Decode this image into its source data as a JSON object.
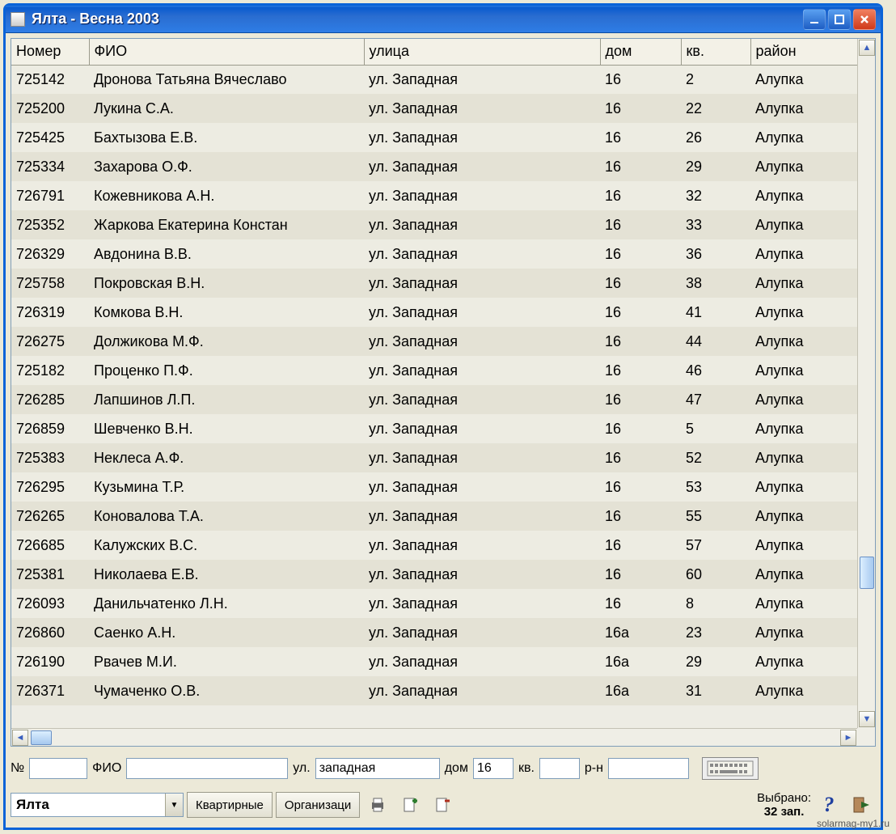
{
  "window": {
    "title": "Ялта  - Весна 2003"
  },
  "table": {
    "headers": {
      "num": "Номер",
      "fio": "ФИО",
      "street": "улица",
      "house": "дом",
      "kv": "кв.",
      "district": "район"
    },
    "rows": [
      {
        "num": "725142",
        "fio": "Дронова Татьяна Вячеславо",
        "street": "ул. Западная",
        "house": "16",
        "kv": "2",
        "district": "Алупка"
      },
      {
        "num": "725200",
        "fio": "Лукина С.А.",
        "street": "ул. Западная",
        "house": "16",
        "kv": "22",
        "district": "Алупка"
      },
      {
        "num": "725425",
        "fio": "Бахтызова Е.В.",
        "street": "ул. Западная",
        "house": "16",
        "kv": "26",
        "district": "Алупка"
      },
      {
        "num": "725334",
        "fio": "Захарова О.Ф.",
        "street": "ул. Западная",
        "house": "16",
        "kv": "29",
        "district": "Алупка"
      },
      {
        "num": "726791",
        "fio": "Кожевникова А.Н.",
        "street": "ул. Западная",
        "house": "16",
        "kv": "32",
        "district": "Алупка"
      },
      {
        "num": "725352",
        "fio": "Жаркова Екатерина Констан",
        "street": "ул. Западная",
        "house": "16",
        "kv": "33",
        "district": "Алупка"
      },
      {
        "num": "726329",
        "fio": "Авдонина В.В.",
        "street": "ул. Западная",
        "house": "16",
        "kv": "36",
        "district": "Алупка"
      },
      {
        "num": "725758",
        "fio": "Покровская В.Н.",
        "street": "ул. Западная",
        "house": "16",
        "kv": "38",
        "district": "Алупка"
      },
      {
        "num": "726319",
        "fio": "Комкова В.Н.",
        "street": "ул. Западная",
        "house": "16",
        "kv": "41",
        "district": "Алупка"
      },
      {
        "num": "726275",
        "fio": "Должикова М.Ф.",
        "street": "ул. Западная",
        "house": "16",
        "kv": "44",
        "district": "Алупка"
      },
      {
        "num": "725182",
        "fio": "Проценко П.Ф.",
        "street": "ул. Западная",
        "house": "16",
        "kv": "46",
        "district": "Алупка"
      },
      {
        "num": "726285",
        "fio": "Лапшинов Л.П.",
        "street": "ул. Западная",
        "house": "16",
        "kv": "47",
        "district": "Алупка"
      },
      {
        "num": "726859",
        "fio": "Шевченко В.Н.",
        "street": "ул. Западная",
        "house": "16",
        "kv": "5",
        "district": "Алупка"
      },
      {
        "num": "725383",
        "fio": "Неклеса А.Ф.",
        "street": "ул. Западная",
        "house": "16",
        "kv": "52",
        "district": "Алупка"
      },
      {
        "num": "726295",
        "fio": "Кузьмина Т.Р.",
        "street": "ул. Западная",
        "house": "16",
        "kv": "53",
        "district": "Алупка"
      },
      {
        "num": "726265",
        "fio": "Коновалова Т.А.",
        "street": "ул. Западная",
        "house": "16",
        "kv": "55",
        "district": "Алупка"
      },
      {
        "num": "726685",
        "fio": "Калужских В.С.",
        "street": "ул. Западная",
        "house": "16",
        "kv": "57",
        "district": "Алупка"
      },
      {
        "num": "725381",
        "fio": "Николаева Е.В.",
        "street": "ул. Западная",
        "house": "16",
        "kv": "60",
        "district": "Алупка"
      },
      {
        "num": "726093",
        "fio": "Данильчатенко Л.Н.",
        "street": "ул. Западная",
        "house": "16",
        "kv": "8",
        "district": "Алупка"
      },
      {
        "num": "726860",
        "fio": "Саенко А.Н.",
        "street": "ул. Западная",
        "house": "16а",
        "kv": "23",
        "district": "Алупка"
      },
      {
        "num": "726190",
        "fio": "Рвачев М.И.",
        "street": "ул. Западная",
        "house": "16а",
        "kv": "29",
        "district": "Алупка"
      },
      {
        "num": "726371",
        "fio": "Чумаченко О.В.",
        "street": "ул. Западная",
        "house": "16а",
        "kv": "31",
        "district": "Алупка"
      }
    ]
  },
  "search": {
    "labels": {
      "num": "№",
      "fio": "ФИО",
      "street": "ул.",
      "house": "дом",
      "kv": "кв.",
      "district": "р-н"
    },
    "values": {
      "num": "",
      "fio": "",
      "street": "западная",
      "house": "16",
      "kv": "",
      "district": ""
    }
  },
  "toolbar": {
    "city_combo": "Ялта",
    "btn_apartments": "Квартирные",
    "btn_organizations": "Организаци",
    "selected_label1": "Выбрано:",
    "selected_label2": "32 зап."
  },
  "watermark": "solarmag-my1.ru"
}
